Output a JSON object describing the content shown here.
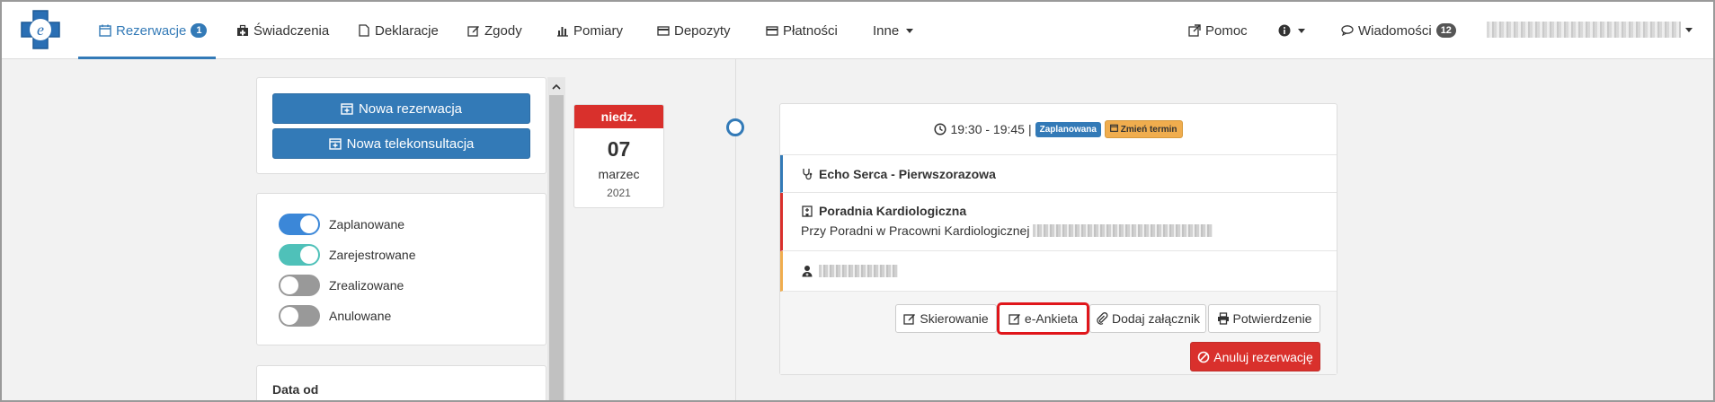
{
  "navbar": {
    "items": [
      {
        "label": "Rezerwacje",
        "badge": "1",
        "icon": "calendar-icon",
        "active": true
      },
      {
        "label": "Świadczenia",
        "icon": "medkit-icon"
      },
      {
        "label": "Deklaracje",
        "icon": "file-icon"
      },
      {
        "label": "Zgody",
        "icon": "edit-icon"
      },
      {
        "label": "Pomiary",
        "icon": "bar-chart-icon"
      },
      {
        "label": "Depozyty",
        "icon": "card-icon"
      },
      {
        "label": "Płatności",
        "icon": "credit-card-icon"
      },
      {
        "label": "Inne",
        "icon": "caret-down-icon"
      }
    ],
    "help_label": "Pomoc",
    "messages_label": "Wiadomości",
    "messages_badge": "12",
    "accent_color": "#337ab7"
  },
  "left_panel": {
    "new_reservation": "Nowa rezerwacja",
    "new_teleconsultation": "Nowa telekonsultacja",
    "filters": [
      {
        "label": "Zaplanowane",
        "state": "on",
        "color": "#3b87d8"
      },
      {
        "label": "Zarejestrowane",
        "state": "on",
        "color": "#4fc1b9"
      },
      {
        "label": "Zrealizowane",
        "state": "off"
      },
      {
        "label": "Anulowane",
        "state": "off"
      }
    ],
    "date_from_label": "Data od"
  },
  "date_card": {
    "weekday": "niedz.",
    "day": "07",
    "month": "marzec",
    "year": "2021"
  },
  "reservation": {
    "time": "19:30 - 19:45",
    "separator": "|",
    "status": "Zaplanowana",
    "change_term": "Zmień termin",
    "service": "Echo Serca - Pierwszorazowa",
    "clinic": "Poradnia Kardiologiczna",
    "clinic_sub": "Przy Poradni w Pracowni Kardiologicznej",
    "buttons": {
      "referral": "Skierowanie",
      "survey": "e-Ankieta",
      "attachment": "Dodaj załącznik",
      "confirmation": "Potwierdzenie",
      "cancel": "Anuluj rezerwację"
    }
  }
}
